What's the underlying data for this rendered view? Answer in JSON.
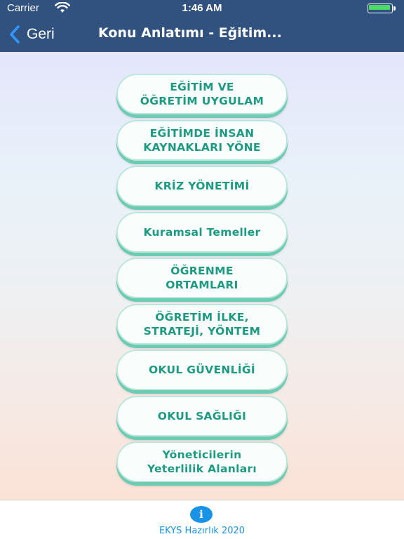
{
  "status_bar": {
    "carrier": "Carrier",
    "time": "1:46 AM",
    "battery_color": "#4cd964"
  },
  "nav": {
    "back_label": "Geri",
    "title": "Konu Anlatımı - Eğitim...",
    "bar_color": "#31517f"
  },
  "menu": {
    "items": [
      {
        "label": "EĞİTİM VE\nÖĞRETİM UYGULAM"
      },
      {
        "label": "EĞİTİMDE İNSAN\nKAYNAKLARI YÖNE"
      },
      {
        "label": "KRİZ YÖNETİMİ"
      },
      {
        "label": "Kuramsal Temeller"
      },
      {
        "label": "ÖĞRENME\nORTAMLARI"
      },
      {
        "label": "ÖĞRETİM İLKE,\nSTRATEJİ, YÖNTEM"
      },
      {
        "label": "OKUL GÜVENLİĞİ"
      },
      {
        "label": "OKUL SAĞLIĞI"
      },
      {
        "label": "Yöneticilerin\nYeterlilik Alanları"
      }
    ],
    "text_color": "#1f9a82",
    "shadow_color": "#6ccbb2"
  },
  "tab_bar": {
    "icon": "info-icon",
    "icon_glyph": "i",
    "label": "EKYS Hazırlık 2020",
    "accent": "#1a93e6"
  }
}
